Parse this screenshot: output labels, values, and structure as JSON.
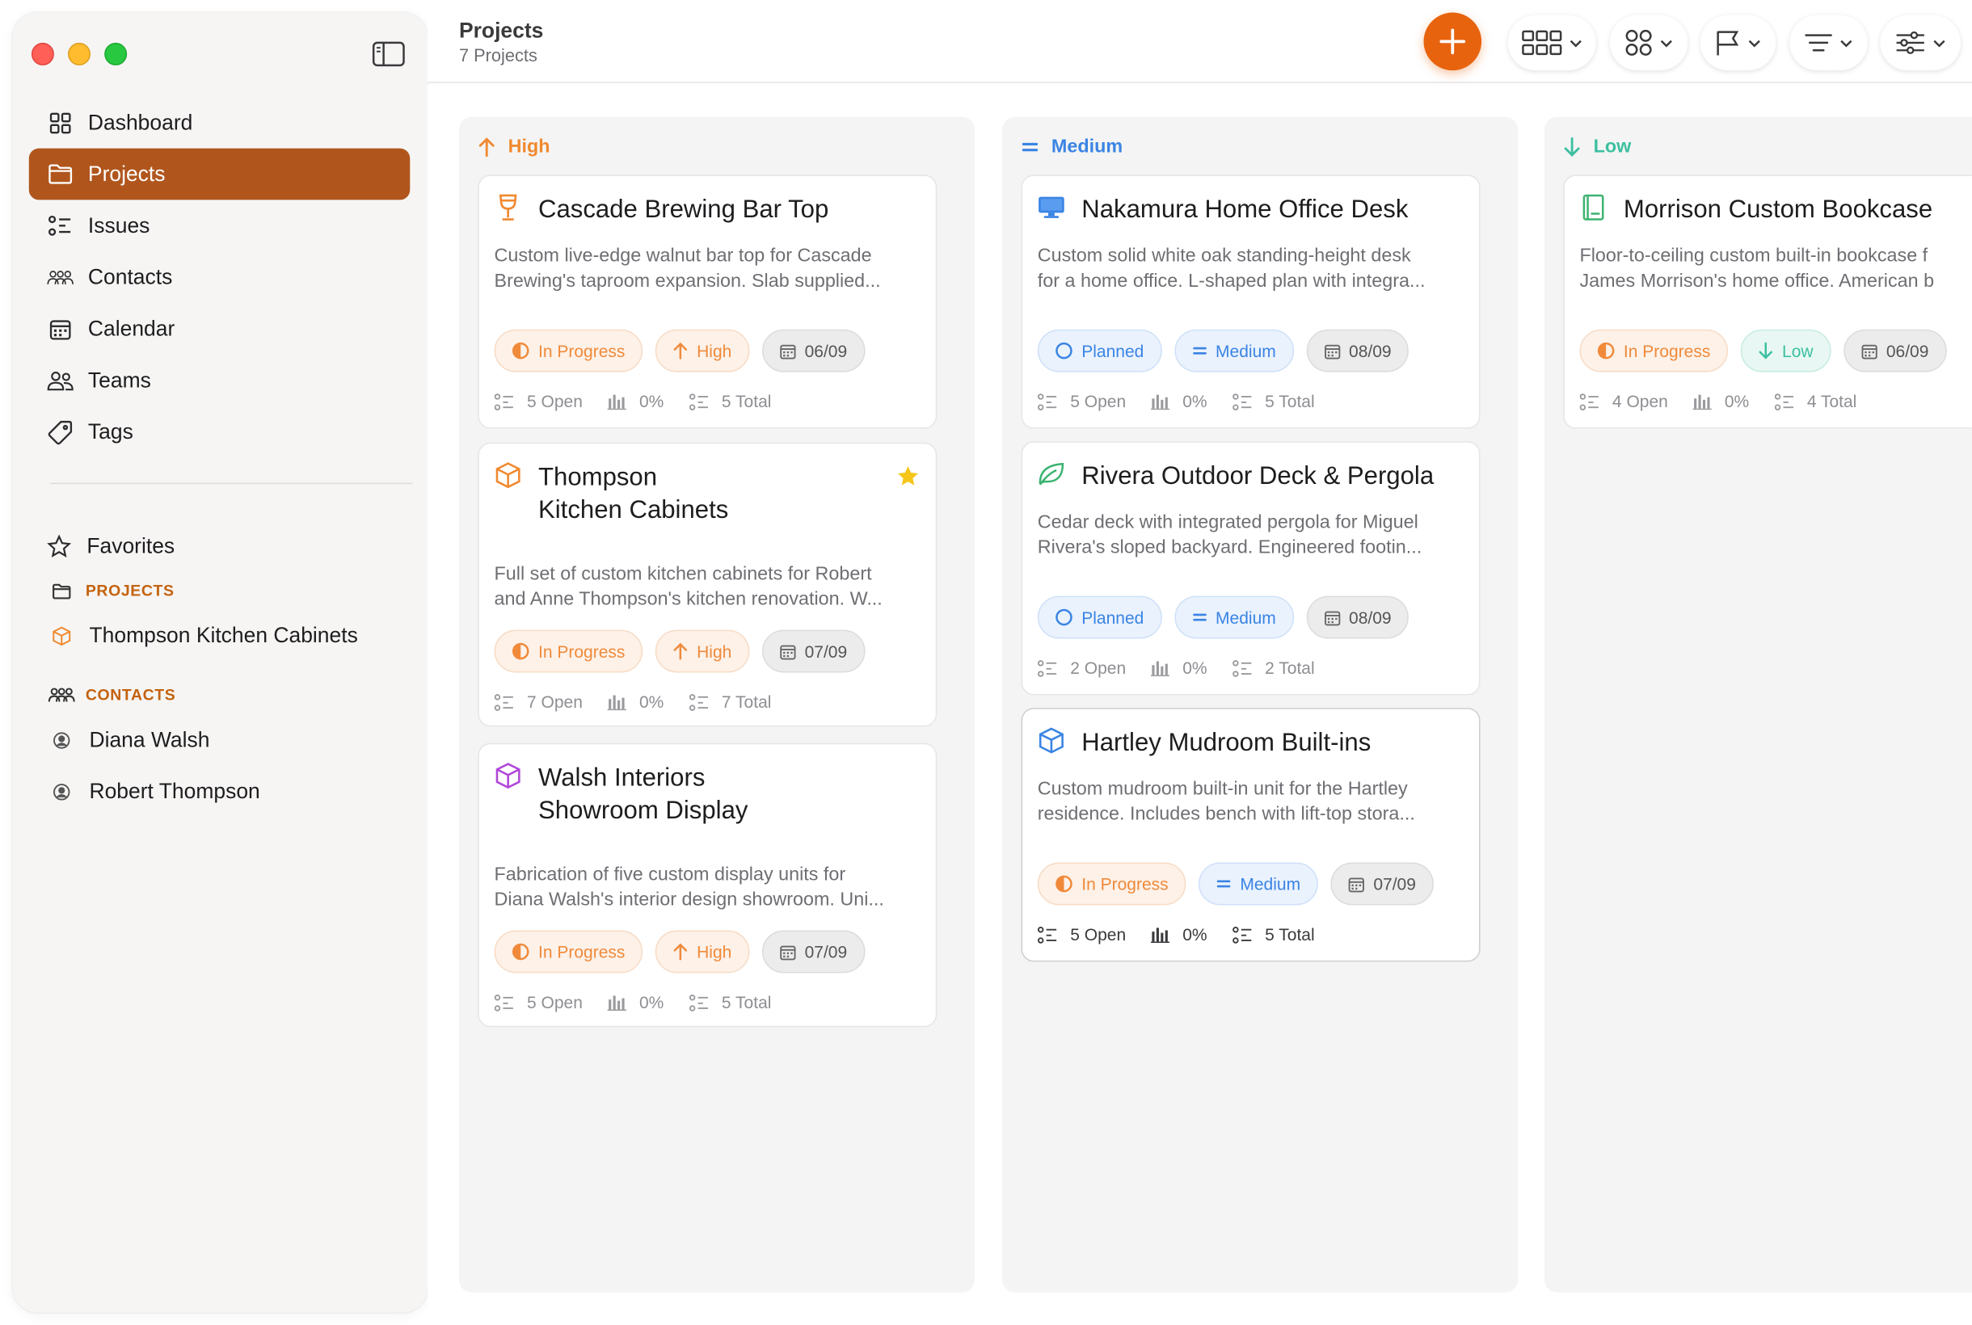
{
  "header": {
    "title": "Projects",
    "subtitle": "7 Projects"
  },
  "sidebar": {
    "nav": [
      {
        "label": "Dashboard",
        "icon": "grid-icon",
        "active": false
      },
      {
        "label": "Projects",
        "icon": "folder-icon",
        "active": true
      },
      {
        "label": "Issues",
        "icon": "checklist-icon",
        "active": false
      },
      {
        "label": "Contacts",
        "icon": "people-group-icon",
        "active": false
      },
      {
        "label": "Calendar",
        "icon": "calendar-icon",
        "active": false
      },
      {
        "label": "Teams",
        "icon": "people-icon",
        "active": false
      },
      {
        "label": "Tags",
        "icon": "tag-icon",
        "active": false
      }
    ],
    "favorites_label": "Favorites",
    "projects_section": "PROJECTS",
    "favorite_projects": [
      "Thompson Kitchen Cabinets"
    ],
    "contacts_section": "CONTACTS",
    "favorite_contacts": [
      "Diana Walsh",
      "Robert Thompson"
    ]
  },
  "columns": [
    {
      "label": "High",
      "color": "#f0892f",
      "cards": [
        {
          "title": [
            "Cascade Brewing Bar Top"
          ],
          "icon": "wine-glass-icon",
          "icon_color": "#f0892f",
          "desc": [
            "Custom live-edge walnut bar top for Cascade",
            "Brewing's taproom expansion. Slab supplied..."
          ],
          "status": "In Progress",
          "priority": "High",
          "date": "06/09",
          "open": "5 Open",
          "pct": "0%",
          "total": "5 Total",
          "starred": false
        },
        {
          "title": [
            "Thompson",
            "Kitchen Cabinets"
          ],
          "icon": "box-icon",
          "icon_color": "#f0892f",
          "desc": [
            "Full set of custom kitchen cabinets for Robert",
            "and Anne Thompson's kitchen renovation. W..."
          ],
          "status": "In Progress",
          "priority": "High",
          "date": "07/09",
          "open": "7 Open",
          "pct": "0%",
          "total": "7 Total",
          "starred": true
        },
        {
          "title": [
            "Walsh Interiors",
            "Showroom Display"
          ],
          "icon": "box-icon",
          "icon_color": "#b048d8",
          "desc": [
            "Fabrication of five custom display units for",
            "Diana Walsh's interior design showroom. Uni..."
          ],
          "status": "In Progress",
          "priority": "High",
          "date": "07/09",
          "open": "5 Open",
          "pct": "0%",
          "total": "5 Total",
          "starred": false
        }
      ]
    },
    {
      "label": "Medium",
      "color": "#3a84e4",
      "cards": [
        {
          "title": [
            "Nakamura Home Office Desk"
          ],
          "icon": "monitor-icon",
          "icon_color": "#3a84e4",
          "desc": [
            "Custom solid white oak standing-height desk",
            "for a home office. L-shaped plan with integra..."
          ],
          "status": "Planned",
          "priority": "Medium",
          "date": "08/09",
          "open": "5 Open",
          "pct": "0%",
          "total": "5 Total",
          "starred": false
        },
        {
          "title": [
            "Rivera Outdoor Deck & Pergola"
          ],
          "icon": "leaf-icon",
          "icon_color": "#3cb371",
          "desc": [
            "Cedar deck with integrated pergola for Miguel",
            "Rivera's sloped backyard. Engineered footin..."
          ],
          "status": "Planned",
          "priority": "Medium",
          "date": "08/09",
          "open": "2 Open",
          "pct": "0%",
          "total": "2 Total",
          "starred": false
        },
        {
          "title": [
            "Hartley Mudroom Built-ins"
          ],
          "icon": "box-icon",
          "icon_color": "#3a84e4",
          "desc": [
            "Custom mudroom built-in unit for the Hartley",
            "residence. Includes bench with lift-top stora..."
          ],
          "status": "In Progress",
          "priority": "Medium",
          "date": "07/09",
          "open": "5 Open",
          "pct": "0%",
          "total": "5 Total",
          "starred": false
        }
      ]
    },
    {
      "label": "Low",
      "color": "#3cc0a0",
      "cards": [
        {
          "title": [
            "Morrison Custom Bookcase"
          ],
          "icon": "book-icon",
          "icon_color": "#3cb371",
          "desc": [
            "Floor-to-ceiling custom built-in bookcase f",
            "James Morrison's home office. American b"
          ],
          "status": "In Progress",
          "priority": "Low",
          "date": "06/09",
          "open": "4 Open",
          "pct": "0%",
          "total": "4 Total",
          "starred": false
        }
      ]
    }
  ]
}
